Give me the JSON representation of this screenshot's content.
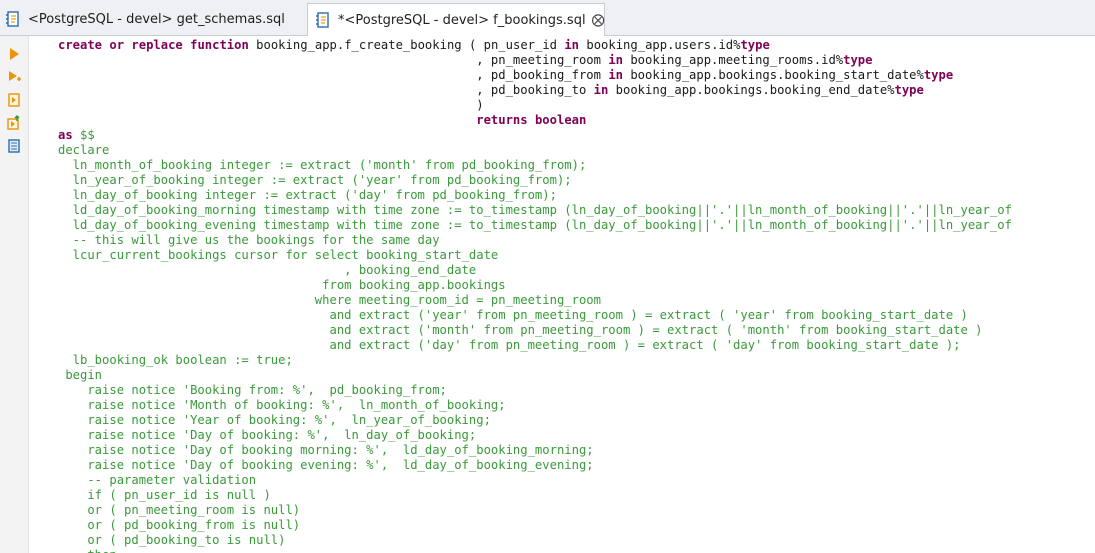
{
  "tabs": [
    {
      "label": "<PostgreSQL - devel> get_schemas.sql",
      "active": false
    },
    {
      "label": "*<PostgreSQL - devel> f_bookings.sql",
      "active": true
    }
  ],
  "gutter_icons": [
    "execute-statement-icon",
    "execute-script-icon",
    "explain-plan-icon",
    "load-plan-icon",
    "export-icon"
  ],
  "colors": {
    "keyword": "#7f0055",
    "plain_text": "#1a1a1a",
    "body_text": "#3a9a3a"
  },
  "code_lines": [
    "create or replace function booking_app.f_create_booking ( pn_user_id in booking_app.users.id%type",
    "                                                         , pn_meeting_room in booking_app.meeting_rooms.id%type",
    "                                                         , pd_booking_from in booking_app.bookings.booking_start_date%type",
    "                                                         , pd_booking_to in booking_app.bookings.booking_end_date%type",
    "                                                         )",
    "                                                         returns boolean",
    "as $$",
    "declare",
    "  ln_month_of_booking integer := extract ('month' from pd_booking_from);",
    "  ln_year_of_booking integer := extract ('year' from pd_booking_from);",
    "  ln_day_of_booking integer := extract ('day' from pd_booking_from);",
    "  ld_day_of_booking_morning timestamp with time zone := to_timestamp (ln_day_of_booking||'.'||ln_month_of_booking||'.'||ln_year_of",
    "  ld_day_of_booking_evening timestamp with time zone := to_timestamp (ln_day_of_booking||'.'||ln_month_of_booking||'.'||ln_year_of",
    "  -- this will give us the bookings for the same day",
    "  lcur_current_bookings cursor for select booking_start_date",
    "                                       , booking_end_date",
    "                                    from booking_app.bookings",
    "                                   where meeting_room_id = pn_meeting_room",
    "                                     and extract ('year' from pn_meeting_room ) = extract ( 'year' from booking_start_date )",
    "                                     and extract ('month' from pn_meeting_room ) = extract ( 'month' from booking_start_date )",
    "                                     and extract ('day' from pn_meeting_room ) = extract ( 'day' from booking_start_date );",
    "  lb_booking_ok boolean := true;",
    " begin",
    "    raise notice 'Booking from: %',  pd_booking_from;",
    "    raise notice 'Month of booking: %',  ln_month_of_booking;",
    "    raise notice 'Year of booking: %',  ln_year_of_booking;",
    "    raise notice 'Day of booking: %',  ln_day_of_booking;",
    "    raise notice 'Day of booking morning: %',  ld_day_of_booking_morning;",
    "    raise notice 'Day of booking evening: %',  ld_day_of_booking_evening;",
    "    -- parameter validation",
    "    if ( pn_user_id is null )",
    "    or ( pn_meeting_room is null)",
    "    or ( pd_booking_from is null)",
    "    or ( pd_booking_to is null)",
    "    then"
  ]
}
